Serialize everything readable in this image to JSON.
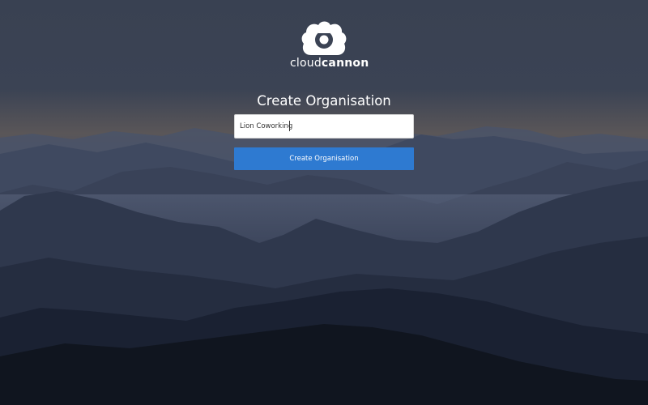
{
  "brand": {
    "logo_icon": "cloud-logo-icon",
    "name_light": "cloud",
    "name_bold": "cannon"
  },
  "form": {
    "title": "Create Organisation",
    "org_name_value": "Lion Coworking",
    "submit_label": "Create Organisation"
  },
  "colors": {
    "accent": "#2e7ad1",
    "sky_top": "#3a4253",
    "sky_horizon": "#5c5a5c",
    "mountain_dark": "#101626"
  }
}
